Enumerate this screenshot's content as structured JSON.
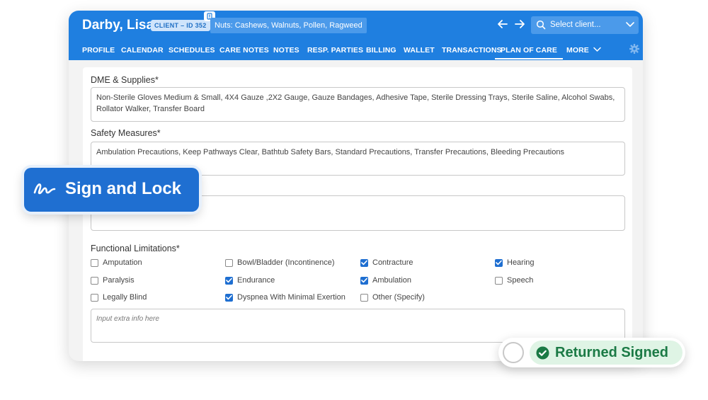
{
  "header": {
    "client_name": "Darby, Lisa",
    "client_badge": "CLIENT – ID 352",
    "allergies": "Nuts: Cashews, Walnuts, Pollen, Ragweed",
    "client_select_placeholder": "Select client..."
  },
  "nav": {
    "items": [
      "PROFILE",
      "CALENDAR",
      "SCHEDULES",
      "CARE NOTES",
      "NOTES",
      "RESP. PARTIES",
      "BILLING",
      "WALLET",
      "TRANSACTIONS",
      "PLAN OF CARE",
      "MORE"
    ],
    "active": "PLAN OF CARE"
  },
  "form": {
    "dme_label": "DME & Supplies*",
    "dme_value": "Non-Sterile Gloves Medium & Small, 4X4 Gauze ,2X2 Gauge, Gauze Bandages, Adhesive Tape, Sterile Dressing Trays, Sterile Saline, Alcohol Swabs, Rollator Walker, Transfer Board",
    "safety_label": "Safety Measures*",
    "safety_value": "Ambulation Precautions, Keep Pathways Clear, Bathtub Safety Bars, Standard Precautions, Transfer Precautions, Bleeding Precautions",
    "functional_label": "Functional Limitations*",
    "checkboxes": [
      {
        "label": "Amputation",
        "checked": false
      },
      {
        "label": "Bowl/Bladder (Incontinence)",
        "checked": false
      },
      {
        "label": "Contracture",
        "checked": true
      },
      {
        "label": "Hearing",
        "checked": true
      },
      {
        "label": "Paralysis",
        "checked": false
      },
      {
        "label": "Endurance",
        "checked": true
      },
      {
        "label": "Ambulation",
        "checked": true
      },
      {
        "label": "Speech",
        "checked": false
      },
      {
        "label": "Legally Blind",
        "checked": false
      },
      {
        "label": "Dyspnea With Minimal Exertion",
        "checked": true
      },
      {
        "label": "Other (Specify)",
        "checked": false
      }
    ],
    "extra_info_placeholder": "Input extra info here"
  },
  "overlays": {
    "sign_and_lock": "Sign and Lock",
    "returned_signed": "Returned Signed"
  },
  "colors": {
    "header_blue": "#1f7fe0",
    "accent_blue": "#1f6fd1",
    "success_green": "#1b7a45"
  }
}
